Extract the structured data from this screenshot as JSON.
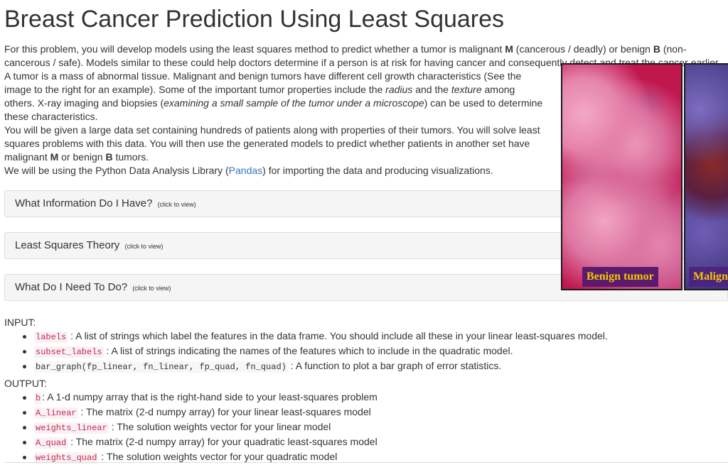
{
  "title": "Breast Cancer Prediction Using Least Squares",
  "intro": {
    "p1_a": "For this problem, you will develop models using the least squares method to predict whether a tumor is malignant ",
    "p1_b1": "M",
    "p1_c": " (cancerous / deadly) or benign ",
    "p1_b2": "B",
    "p1_d": " (non-cancerous / safe). Models similar to these could help doctors determine if a person is at risk for having cancer and consequently detect and treat the cancer earlier.",
    "p2_a": "A tumor is a mass of abnormal tissue. Malignant and benign tumors have different cell growth characteristics (See the image to the right for an example). Some of the important tumor properties include the ",
    "p2_i1": "radius",
    "p2_b": " and the ",
    "p2_i2": "texture",
    "p2_c": " among others. X-ray imaging and biopsies (",
    "p2_i3": "examining a small sample of the tumor under a microscope",
    "p2_d": ") can be used to determine these characteristics.",
    "p3_a": "You will be given a large data set containing hundreds of patients along with properties of their tumors. You will solve least squares problems with this data. You will then use the generated models to predict whether patients in another set have malignant ",
    "p3_b1": "M",
    "p3_c": " or benign ",
    "p3_b2": "B",
    "p3_d": " tumors.",
    "p4_a": "We will be using the Python Data Analysis Library (",
    "p4_link": "Pandas",
    "p4_b": ") for importing the data and producing visualizations."
  },
  "figure": {
    "benign_label": "Benign tumor",
    "malignant_label": "Malign"
  },
  "accordions": [
    {
      "title": "What Information Do I Have?",
      "hint": "(click to view)"
    },
    {
      "title": "Least Squares Theory",
      "hint": "(click to view)"
    },
    {
      "title": "What Do I Need To Do?",
      "hint": "(click to view)"
    }
  ],
  "input": {
    "label": "INPUT:",
    "items": [
      {
        "code": "labels",
        "text": ": A list of strings which label the features in the data frame. You should include all these in your linear least-squares model."
      },
      {
        "code": "subset_labels",
        "text": ": A list of strings indicating the names of the features which to include in the quadratic model."
      },
      {
        "code": "bar_graph(fp_linear, fn_linear, fp_quad, fn_quad)",
        "text": ": A function to plot a bar graph of error statistics."
      }
    ]
  },
  "output": {
    "label": "OUTPUT:",
    "items": [
      {
        "code": "b",
        "text": ": A 1-d numpy array that is the right-hand side to your least-squares problem"
      },
      {
        "code": "A_linear",
        "text": ": The matrix (2-d numpy array) for your linear least-squares model"
      },
      {
        "code": "weights_linear",
        "text": ": The solution weights vector for your linear model"
      },
      {
        "code": "A_quad",
        "text": ": The matrix (2-d numpy array) for your quadratic least-squares model"
      },
      {
        "code": "weights_quad",
        "text": ": The solution weights vector for your quadratic model"
      }
    ]
  }
}
